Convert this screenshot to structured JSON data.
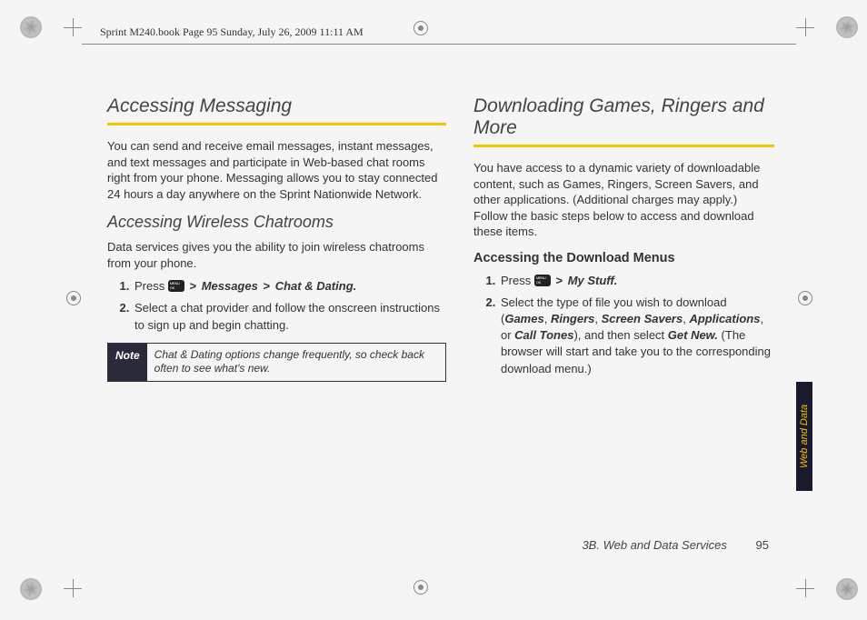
{
  "header": {
    "book_info": "Sprint M240.book  Page 95  Sunday, July 26, 2009  11:11 AM"
  },
  "left": {
    "h1": "Accessing Messaging",
    "intro": "You can send and receive email messages, instant messages, and text messages and participate in Web-based chat rooms right from your phone. Messaging allows you to stay connected 24 hours a day anywhere on the Sprint Nationwide Network.",
    "h2": "Accessing Wireless Chatrooms",
    "p2": "Data services gives you the ability to join wireless chatrooms from your phone.",
    "step1_prefix": "Press ",
    "step1_path_a": "Messages",
    "step1_path_b": "Chat & Dating.",
    "step2": "Select a chat provider and follow the onscreen instructions to sign up and begin chatting.",
    "note_label": "Note",
    "note_text": "Chat & Dating options change frequently, so check back often to see what's new."
  },
  "right": {
    "h1": "Downloading Games, Ringers and More",
    "intro": "You have access to a dynamic variety of downloadable content, such as Games, Ringers, Screen Savers, and other applications. (Additional charges may apply.) Follow the basic steps below to access and download these items.",
    "h3": "Accessing the Download Menus",
    "step1_prefix": "Press ",
    "step1_path": "My Stuff.",
    "step2_a": "Select the type of file you wish to download (",
    "step2_games": "Games",
    "step2_ringers": "Ringers",
    "step2_ss": "Screen Savers",
    "step2_apps": "Applications",
    "step2_or": ", or ",
    "step2_ct": "Call Tones",
    "step2_b": "), and then select ",
    "step2_getnew": "Get New.",
    "step2_c": " (The browser will start and take you to the corresponding download menu.)"
  },
  "sidetab": "Web and Data",
  "footer": {
    "section": "3B. Web and Data Services",
    "page": "95"
  }
}
